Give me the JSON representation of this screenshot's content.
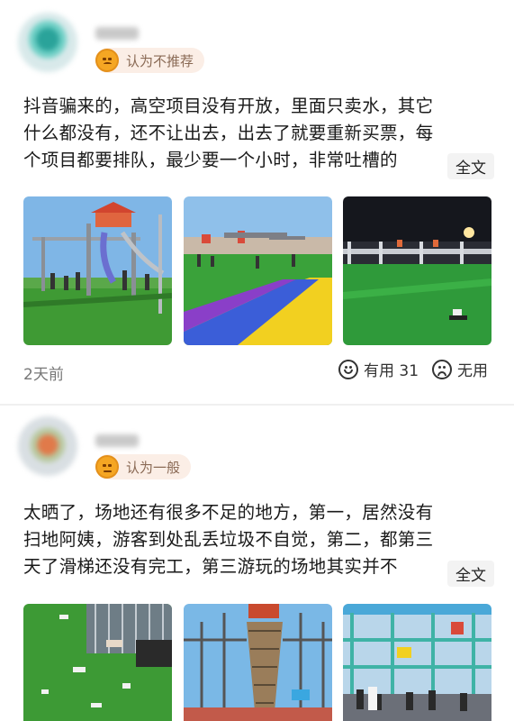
{
  "reviews": [
    {
      "rating_label": "认为不推荐",
      "lines": [
        "抖音骗来的，高空项目没有开放，里面只卖水，其它",
        "什么都没有，还不让出去，出去了就要重新买票，每",
        "个项目都要排队，最少要一个小时，非常吐槽的"
      ],
      "expand_label": "全文",
      "time": "2天前",
      "useful_label": "有用 31",
      "useless_label": "无用"
    },
    {
      "rating_label": "认为一般",
      "lines": [
        "太晒了，场地还有很多不足的地方，第一，居然没有",
        "扫地阿姨，游客到处乱丢垃圾不自觉，第二，都第三",
        "天了滑梯还没有完工，第三游玩的场地其实并不"
      ],
      "expand_label": "全文"
    }
  ],
  "icons": {
    "rating_bad": "unhappy-face-icon",
    "rating_neutral": "neutral-face-icon",
    "useful": "smile-icon",
    "useless": "frown-icon"
  },
  "colors": {
    "rating_bg": "#fbeee6",
    "rating_face": "#f5a623",
    "rating_text": "#8a6a55"
  }
}
